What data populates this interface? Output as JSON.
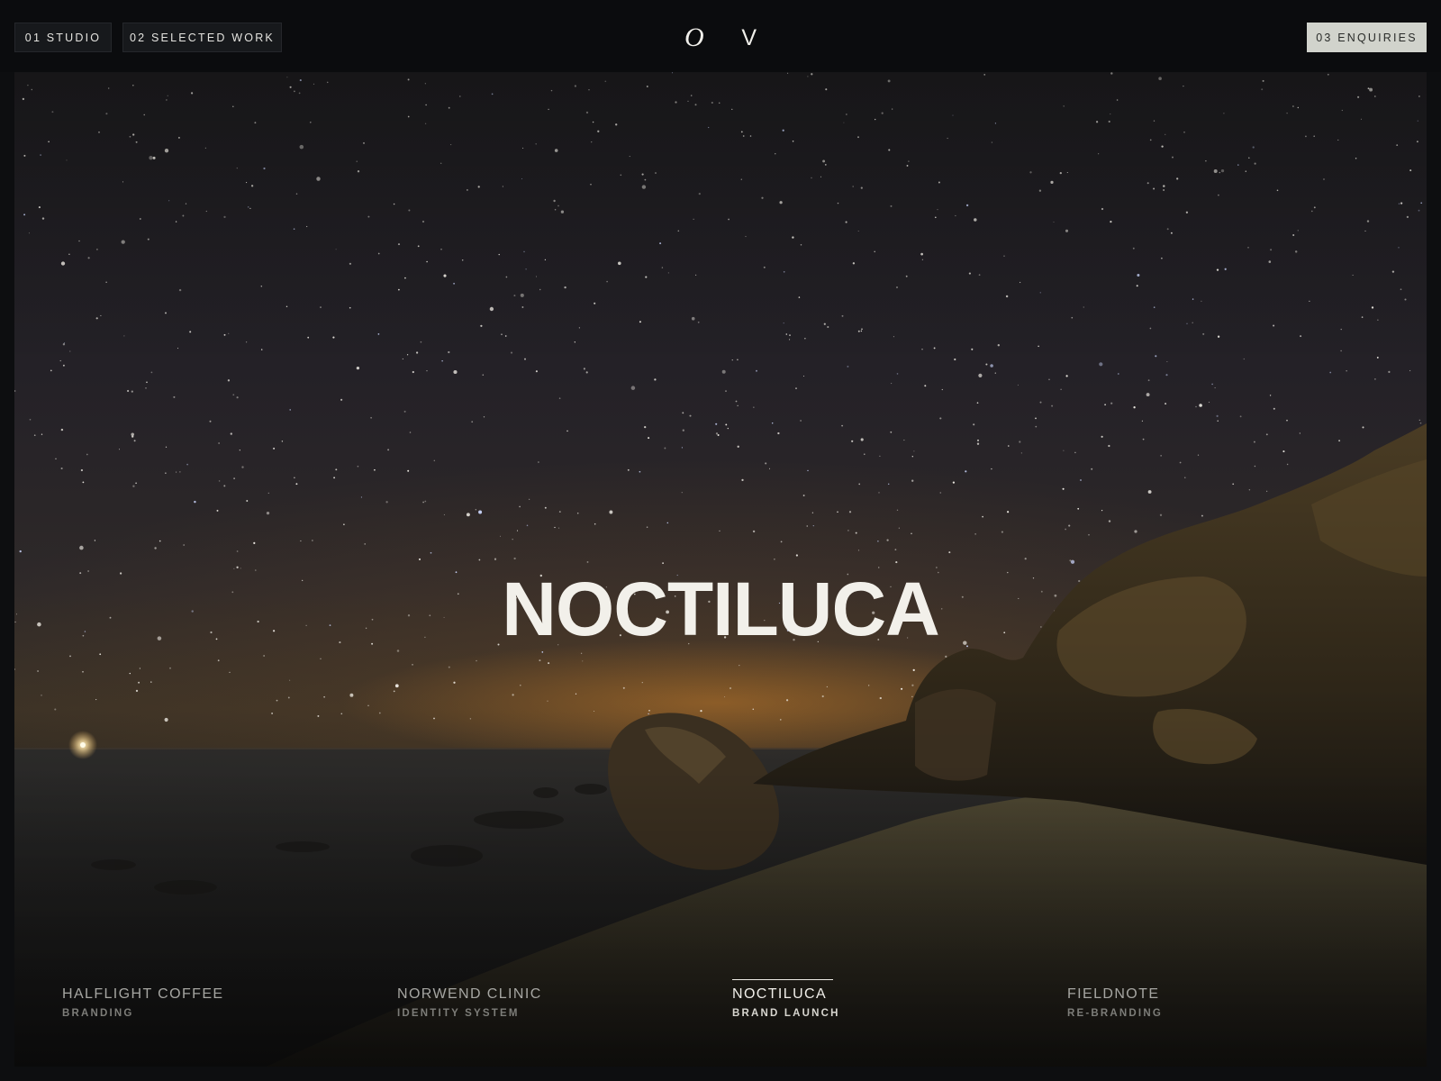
{
  "nav": {
    "studio_label": "01 STUDIO",
    "work_label": "02 SELECTED WORK",
    "enquiries_label": "03 ENQUIRIES"
  },
  "logo": {
    "left_glyph": "O",
    "right_glyph": "V"
  },
  "hero": {
    "title": "NOCTILUCA"
  },
  "projects": [
    {
      "name": "HALFLIGHT COFFEE",
      "category": "BRANDING",
      "active": false
    },
    {
      "name": "NORWEND CLINIC",
      "category": "IDENTITY SYSTEM",
      "active": false
    },
    {
      "name": "NOCTILUCA",
      "category": "BRAND LAUNCH",
      "active": true
    },
    {
      "name": "FIELDNOTE",
      "category": "RE-BRANDING",
      "active": false
    }
  ],
  "colors": {
    "background": "#0d0e10",
    "accent_button": "#d1d3cc",
    "hero_text": "#f2f0ea"
  }
}
